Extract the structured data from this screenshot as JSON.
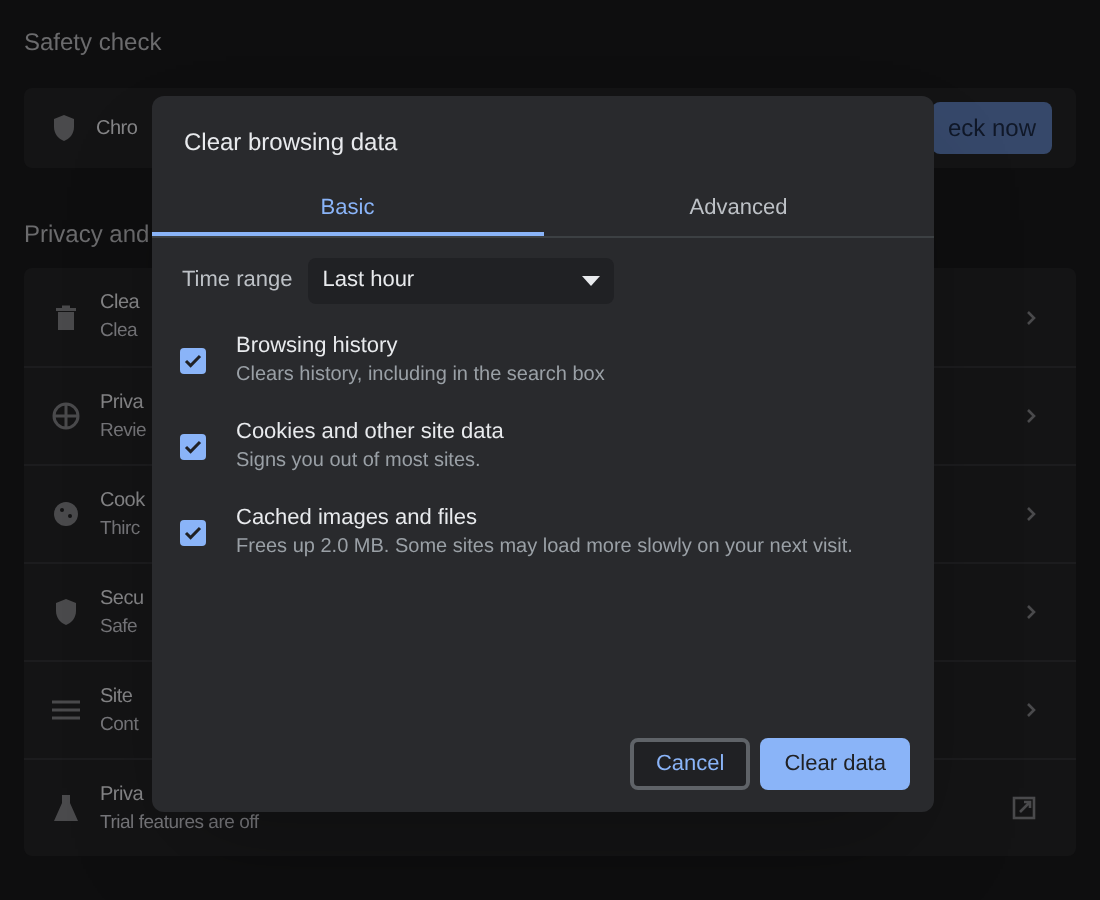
{
  "safety_check": {
    "heading": "Safety check",
    "text": "Chro",
    "button": "eck now"
  },
  "privacy": {
    "heading": "Privacy and",
    "rows": [
      {
        "title": "Clea",
        "subtitle": "Clea",
        "kind": "chevron"
      },
      {
        "title": "Priva",
        "subtitle": "Revie",
        "kind": "chevron"
      },
      {
        "title": "Cook",
        "subtitle": "Thirc",
        "kind": "chevron"
      },
      {
        "title": "Secu",
        "subtitle": "Safe",
        "kind": "chevron"
      },
      {
        "title": "Site",
        "subtitle": "Cont",
        "kind": "chevron"
      },
      {
        "title": "Priva",
        "subtitle": "Trial features are off",
        "kind": "external"
      }
    ]
  },
  "dialog": {
    "title": "Clear browsing data",
    "tabs": [
      {
        "label": "Basic",
        "selected": true
      },
      {
        "label": "Advanced",
        "selected": false
      }
    ],
    "time_range": {
      "label": "Time range",
      "value": "Last hour"
    },
    "options": [
      {
        "title": "Browsing history",
        "subtitle": "Clears history, including in the search box",
        "checked": true
      },
      {
        "title": "Cookies and other site data",
        "subtitle": "Signs you out of most sites.",
        "checked": true
      },
      {
        "title": "Cached images and files",
        "subtitle": "Frees up 2.0 MB. Some sites may load more slowly on your next visit.",
        "checked": true
      }
    ],
    "buttons": [
      {
        "label": "Cancel",
        "kind": "secondary"
      },
      {
        "label": "Clear data",
        "kind": "primary"
      }
    ]
  }
}
